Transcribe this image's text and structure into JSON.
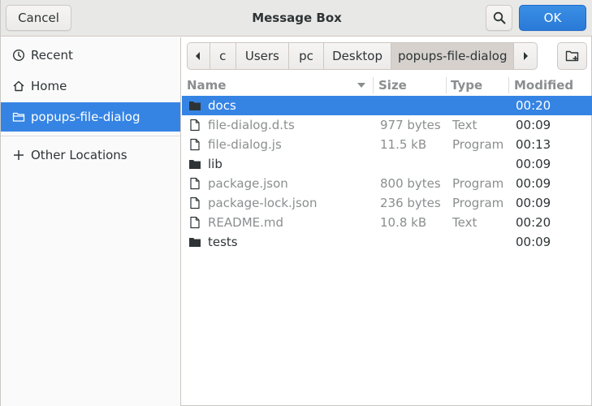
{
  "header": {
    "title": "Message Box",
    "cancel_label": "Cancel",
    "ok_label": "OK"
  },
  "sidebar": {
    "items": [
      {
        "label": "Recent",
        "icon": "clock-icon"
      },
      {
        "label": "Home",
        "icon": "home-icon"
      },
      {
        "label": "popups-file-dialog",
        "icon": "folder-icon",
        "selected": true
      }
    ],
    "other_locations_label": "Other Locations"
  },
  "pathbar": {
    "segments": [
      "c",
      "Users",
      "pc",
      "Desktop",
      "popups-file-dialog"
    ]
  },
  "columns": {
    "name": "Name",
    "size": "Size",
    "type": "Type",
    "modified": "Modified"
  },
  "files": [
    {
      "name": "docs",
      "size": "",
      "type": "",
      "modified": "00:20",
      "kind": "folder"
    },
    {
      "name": "file-dialog.d.ts",
      "size": "977 bytes",
      "type": "Text",
      "modified": "00:09",
      "kind": "file"
    },
    {
      "name": "file-dialog.js",
      "size": "11.5 kB",
      "type": "Program",
      "modified": "00:13",
      "kind": "file"
    },
    {
      "name": "lib",
      "size": "",
      "type": "",
      "modified": "00:09",
      "kind": "folder"
    },
    {
      "name": "package.json",
      "size": "800 bytes",
      "type": "Program",
      "modified": "00:09",
      "kind": "file"
    },
    {
      "name": "package-lock.json",
      "size": "236 bytes",
      "type": "Program",
      "modified": "00:09",
      "kind": "file"
    },
    {
      "name": "README.md",
      "size": "10.8 kB",
      "type": "Text",
      "modified": "00:20",
      "kind": "file"
    },
    {
      "name": "tests",
      "size": "",
      "type": "",
      "modified": "00:09",
      "kind": "folder"
    }
  ],
  "colors": {
    "accent": "#3584e4",
    "ok_button": "#2a7ad8"
  }
}
